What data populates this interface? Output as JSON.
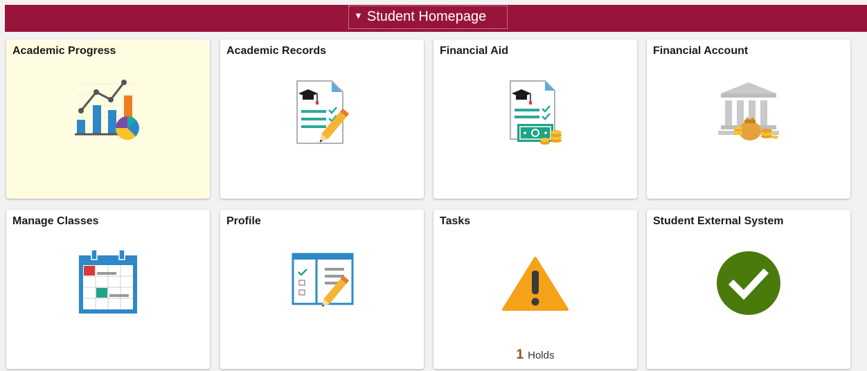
{
  "header": {
    "title": "Student Homepage",
    "caret_icon": "caret-down-icon",
    "bg_color": "#98143a"
  },
  "tiles": [
    {
      "label": "Academic Progress",
      "icon": "chart-icon",
      "highlight_color": "#fefde2"
    },
    {
      "label": "Academic Records",
      "icon": "document-icon"
    },
    {
      "label": "Financial Aid",
      "icon": "financial-document-icon"
    },
    {
      "label": "Financial Account",
      "icon": "bank-icon"
    },
    {
      "label": "Manage Classes",
      "icon": "calendar-icon"
    },
    {
      "label": "Profile",
      "icon": "profile-form-icon"
    },
    {
      "label": "Tasks",
      "icon": "warning-icon",
      "count": "1",
      "count_label": "Holds"
    },
    {
      "label": "Student External System",
      "icon": "check-circle-icon",
      "icon_color": "#4a7a0c"
    }
  ]
}
